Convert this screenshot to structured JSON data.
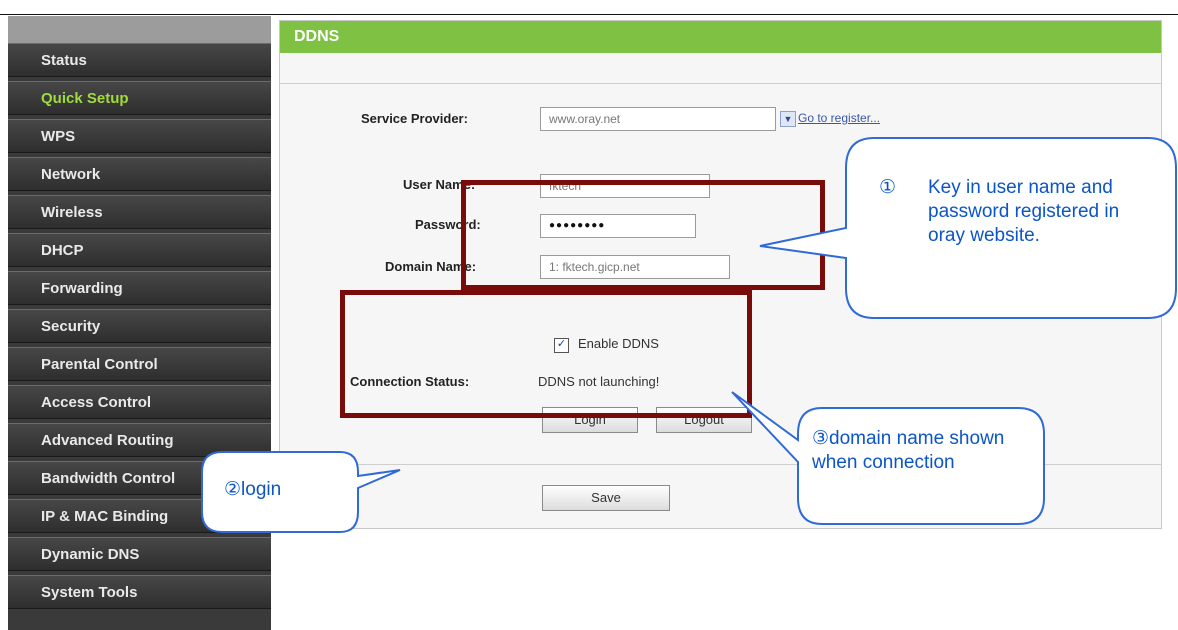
{
  "sidebar": {
    "items": [
      {
        "label": "Status"
      },
      {
        "label": "Quick Setup"
      },
      {
        "label": "WPS"
      },
      {
        "label": "Network"
      },
      {
        "label": "Wireless"
      },
      {
        "label": "DHCP"
      },
      {
        "label": "Forwarding"
      },
      {
        "label": "Security"
      },
      {
        "label": "Parental Control"
      },
      {
        "label": "Access Control"
      },
      {
        "label": "Advanced Routing"
      },
      {
        "label": "Bandwidth Control"
      },
      {
        "label": "IP & MAC Binding"
      },
      {
        "label": "Dynamic DNS"
      },
      {
        "label": "System Tools"
      }
    ],
    "active_color": "#9fdc3a"
  },
  "panel": {
    "title": "DDNS",
    "header_color": "#7fc143"
  },
  "form": {
    "service_provider_label": "Service Provider:",
    "service_provider_value": "www.oray.net",
    "register_link": "Go to register...",
    "username_label": "User Name:",
    "username_value": "fktech",
    "password_label": "Password:",
    "password_value": "●●●●●●●●",
    "domain_label": "Domain Name:",
    "domain_value": "1: fktech.gicp.net",
    "enable_ddns_label": "Enable DDNS",
    "enable_ddns_checked": true,
    "connection_status_label": "Connection Status:",
    "connection_status_value": "DDNS not launching!",
    "login_button": "Login",
    "logout_button": "Logout",
    "save_button": "Save"
  },
  "annotations": {
    "callout1_number": "①",
    "callout1_text": "Key in user name and password registered in oray website.",
    "callout2_text": "②login",
    "callout3_text": "③domain name shown when connection",
    "box_color": "#7a0b0b",
    "text_color": "#0b55c8"
  }
}
